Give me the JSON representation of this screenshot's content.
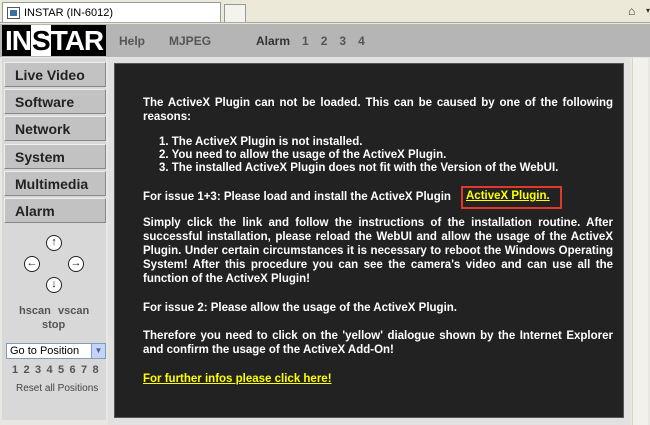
{
  "browser": {
    "tab_title": "INSTAR (IN-6012)"
  },
  "header": {
    "logo": "INSTAR",
    "nav": [
      "Help",
      "MJPEG"
    ],
    "alarm_label": "Alarm",
    "alarm_numbers": [
      "1",
      "2",
      "3",
      "4"
    ]
  },
  "sidebar": {
    "items": [
      "Live Video",
      "Software",
      "Network",
      "System",
      "Multimedia",
      "Alarm"
    ],
    "ptz": {
      "hscan": "hscan",
      "vscan": "vscan",
      "stop": "stop"
    },
    "position_select": "Go to Position",
    "presets": [
      "1",
      "2",
      "3",
      "4",
      "5",
      "6",
      "7",
      "8"
    ],
    "reset_label": "Reset all Positions"
  },
  "main": {
    "intro": "The ActiveX Plugin can not be loaded. This can be caused by one of the following reasons:",
    "reasons": [
      "1.  The ActiveX Plugin is not installed.",
      "2.  You need to allow the usage of the ActiveX Plugin.",
      "3.  The installed ActiveX Plugin does not fit with the Version of the WebUI."
    ],
    "issue13": "For issue 1+3: Please load and install the ActiveX Plugin",
    "plugin_link": "ActiveX Plugin.",
    "instructions": "Simply click the link and follow the instructions of the installation routine. After successful installation, please reload the WebUI and allow the usage of the ActiveX Plugin. Under certain circumstances it is necessary to reboot the Windows Operating System! After this procedure you can see the camera's video and can use all the function of the ActiveX Plugin!",
    "issue2": "For issue 2: Please allow the usage of the ActiveX Plugin.",
    "yellow_dialog": "Therefore you need to click on the 'yellow' dialogue shown by the Internet Explorer and confirm the usage of the ActiveX Add-On!",
    "further_link": "For further infos please click here!"
  },
  "colors": {
    "panel_bg": "#222222",
    "link": "#ffff00",
    "highlight_border": "#e0382c"
  }
}
